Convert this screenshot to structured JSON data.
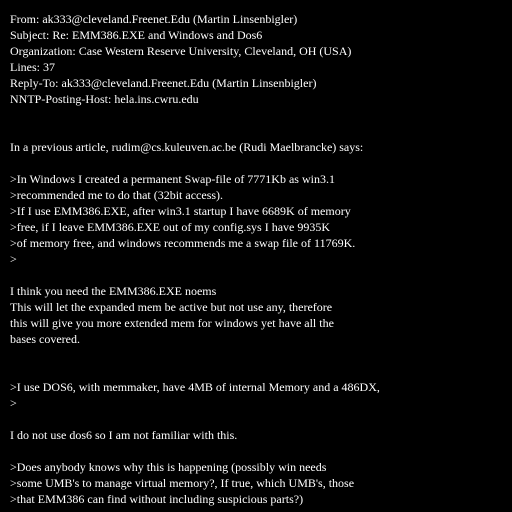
{
  "theme": {
    "background": "#000000",
    "text_color": "#ffffff"
  },
  "message": {
    "lines": [
      "From: ak333@cleveland.Freenet.Edu (Martin Linsenbigler)",
      "Subject: Re: EMM386.EXE and Windows and Dos6",
      "Organization: Case Western Reserve University, Cleveland, OH (USA)",
      "Lines: 37",
      "Reply-To: ak333@cleveland.Freenet.Edu (Martin Linsenbigler)",
      "NNTP-Posting-Host: hela.ins.cwru.edu",
      "",
      "",
      "In a previous article, rudim@cs.kuleuven.ac.be (Rudi Maelbrancke) says:",
      "",
      ">In Windows I created a permanent Swap-file of 7771Kb as win3.1",
      ">recommended me to do that (32bit access).",
      ">If I use EMM386.EXE, after win3.1 startup I have 6689K of memory",
      ">free, if I leave EMM386.EXE out of my config.sys I have 9935K",
      ">of memory free, and windows recommends me a swap file of 11769K.",
      ">",
      "",
      "I think you need the EMM386.EXE noems",
      "This will let the expanded mem be active but not use any, therefore",
      "this will give you more extended mem for windows yet have all the",
      "bases covered.",
      "",
      "",
      ">I use DOS6, with memmaker, have 4MB of internal Memory and a 486DX,",
      ">",
      "",
      "I do not use dos6 so I am not familiar with this.",
      "",
      ">Does anybody knows why this is happening (possibly win needs",
      ">some UMB's to manage virtual memory?, If true, which UMB's, those",
      ">that EMM386 can find without including suspicious parts?)",
      ">"
    ]
  }
}
